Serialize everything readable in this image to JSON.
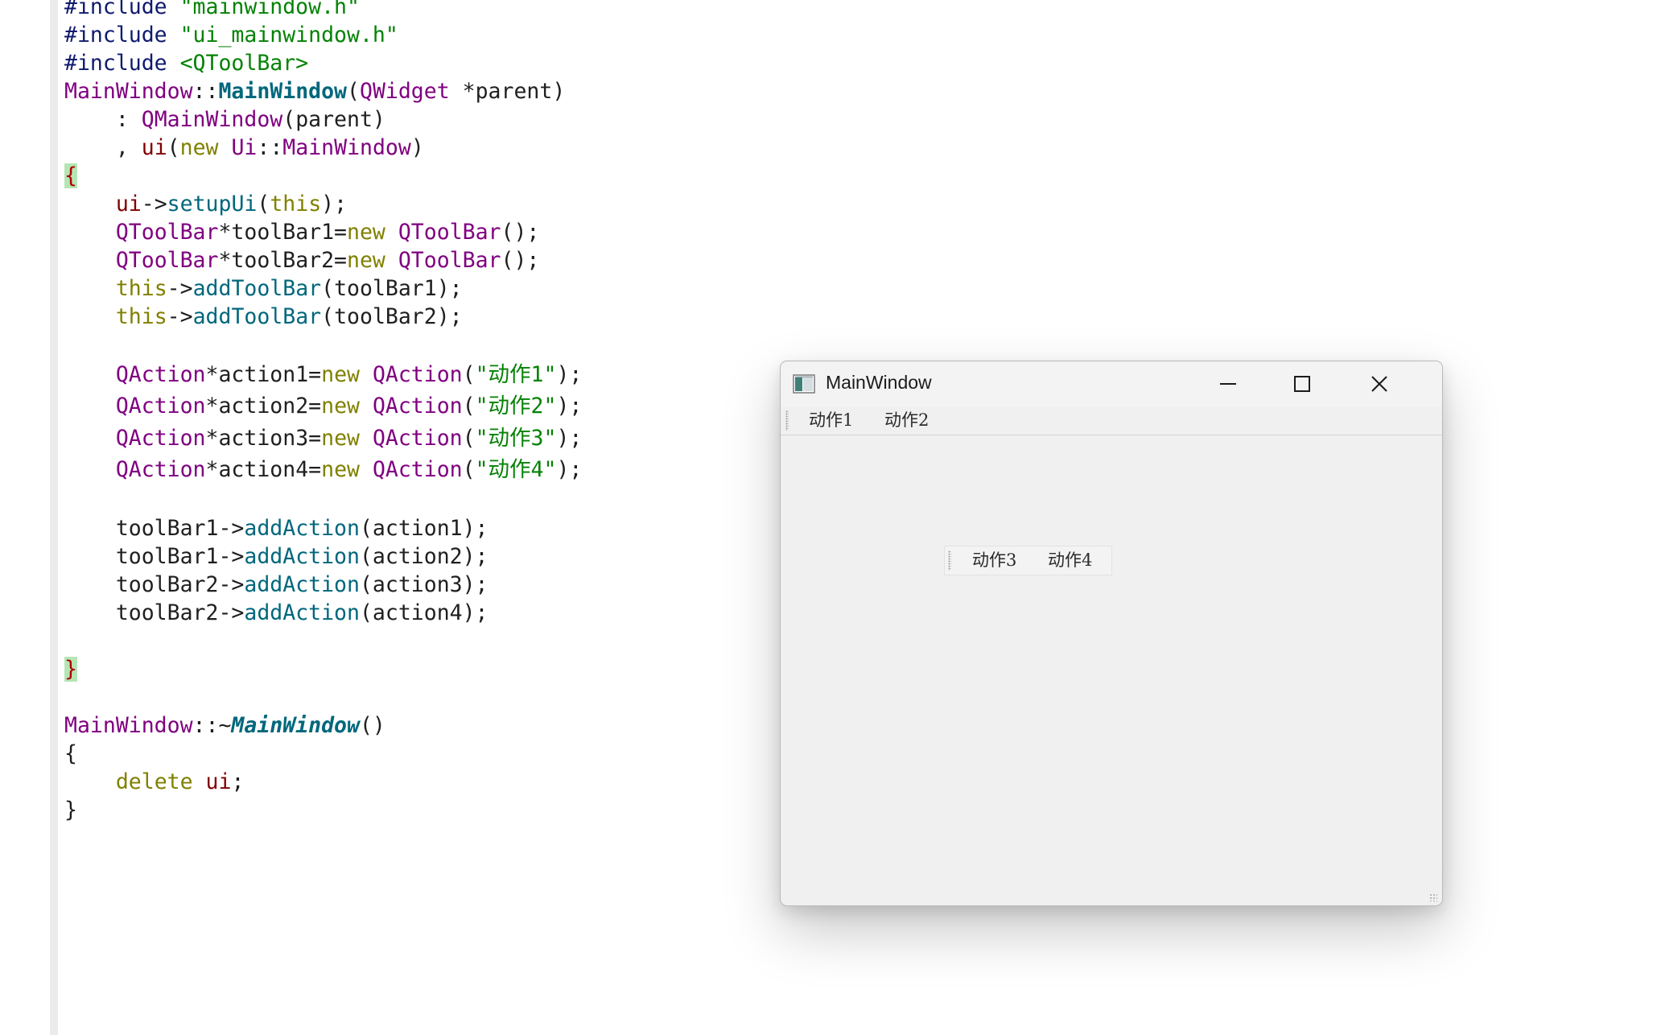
{
  "editor": {
    "lines": [
      [
        {
          "t": "#include ",
          "c": "tok-kw-pp"
        },
        {
          "t": "\"mainwindow.h\"",
          "c": "tok-str"
        }
      ],
      [
        {
          "t": "#include ",
          "c": "tok-kw-pp"
        },
        {
          "t": "\"ui_mainwindow.h\"",
          "c": "tok-str"
        }
      ],
      [
        {
          "t": "#include ",
          "c": "tok-kw-pp"
        },
        {
          "t": "<QToolBar>",
          "c": "tok-hdr"
        }
      ],
      [
        {
          "t": "MainWindow",
          "c": "tok-type"
        },
        {
          "t": "::",
          "c": "tok-punct"
        },
        {
          "t": "MainWindow",
          "c": "tok-fn-decl"
        },
        {
          "t": "(",
          "c": "tok-punct"
        },
        {
          "t": "QWidget",
          "c": "tok-type"
        },
        {
          "t": " *",
          "c": "tok-punct"
        },
        {
          "t": "parent",
          "c": "tok-plain"
        },
        {
          "t": ")",
          "c": "tok-punct"
        }
      ],
      [
        {
          "t": "    : ",
          "c": "tok-punct"
        },
        {
          "t": "QMainWindow",
          "c": "tok-type"
        },
        {
          "t": "(parent)",
          "c": "tok-punct"
        }
      ],
      [
        {
          "t": "    , ",
          "c": "tok-punct"
        },
        {
          "t": "ui",
          "c": "tok-member"
        },
        {
          "t": "(",
          "c": "tok-punct"
        },
        {
          "t": "new ",
          "c": "tok-kw"
        },
        {
          "t": "Ui",
          "c": "tok-type"
        },
        {
          "t": "::",
          "c": "tok-punct"
        },
        {
          "t": "MainWindow",
          "c": "tok-type"
        },
        {
          "t": ")",
          "c": "tok-punct"
        }
      ],
      [
        {
          "t": "{",
          "c": "tok-brace-hl"
        }
      ],
      [
        {
          "t": "    ",
          "c": "tok-plain"
        },
        {
          "t": "ui",
          "c": "tok-member"
        },
        {
          "t": "->",
          "c": "tok-punct"
        },
        {
          "t": "setupUi",
          "c": "tok-fn"
        },
        {
          "t": "(",
          "c": "tok-punct"
        },
        {
          "t": "this",
          "c": "tok-kw"
        },
        {
          "t": ");",
          "c": "tok-punct"
        }
      ],
      [
        {
          "t": "    ",
          "c": "tok-plain"
        },
        {
          "t": "QToolBar",
          "c": "tok-type"
        },
        {
          "t": "*toolBar1=",
          "c": "tok-punct"
        },
        {
          "t": "new ",
          "c": "tok-kw"
        },
        {
          "t": "QToolBar",
          "c": "tok-type"
        },
        {
          "t": "();",
          "c": "tok-punct"
        }
      ],
      [
        {
          "t": "    ",
          "c": "tok-plain"
        },
        {
          "t": "QToolBar",
          "c": "tok-type"
        },
        {
          "t": "*toolBar2=",
          "c": "tok-punct"
        },
        {
          "t": "new ",
          "c": "tok-kw"
        },
        {
          "t": "QToolBar",
          "c": "tok-type"
        },
        {
          "t": "();",
          "c": "tok-punct"
        }
      ],
      [
        {
          "t": "    ",
          "c": "tok-plain"
        },
        {
          "t": "this",
          "c": "tok-kw"
        },
        {
          "t": "->",
          "c": "tok-punct"
        },
        {
          "t": "addToolBar",
          "c": "tok-fn"
        },
        {
          "t": "(toolBar1);",
          "c": "tok-punct"
        }
      ],
      [
        {
          "t": "    ",
          "c": "tok-plain"
        },
        {
          "t": "this",
          "c": "tok-kw"
        },
        {
          "t": "->",
          "c": "tok-punct"
        },
        {
          "t": "addToolBar",
          "c": "tok-fn"
        },
        {
          "t": "(toolBar2);",
          "c": "tok-punct"
        }
      ],
      [],
      [
        {
          "t": "    ",
          "c": "tok-plain"
        },
        {
          "t": "QAction",
          "c": "tok-type"
        },
        {
          "t": "*action1=",
          "c": "tok-punct"
        },
        {
          "t": "new ",
          "c": "tok-kw"
        },
        {
          "t": "QAction",
          "c": "tok-type"
        },
        {
          "t": "(",
          "c": "tok-punct"
        },
        {
          "t": "\"动作1\"",
          "c": "tok-str"
        },
        {
          "t": ");",
          "c": "tok-punct"
        }
      ],
      [
        {
          "t": "    ",
          "c": "tok-plain"
        },
        {
          "t": "QAction",
          "c": "tok-type"
        },
        {
          "t": "*action2=",
          "c": "tok-punct"
        },
        {
          "t": "new ",
          "c": "tok-kw"
        },
        {
          "t": "QAction",
          "c": "tok-type"
        },
        {
          "t": "(",
          "c": "tok-punct"
        },
        {
          "t": "\"动作2\"",
          "c": "tok-str"
        },
        {
          "t": ");",
          "c": "tok-punct"
        }
      ],
      [
        {
          "t": "    ",
          "c": "tok-plain"
        },
        {
          "t": "QAction",
          "c": "tok-type"
        },
        {
          "t": "*action3=",
          "c": "tok-punct"
        },
        {
          "t": "new ",
          "c": "tok-kw"
        },
        {
          "t": "QAction",
          "c": "tok-type"
        },
        {
          "t": "(",
          "c": "tok-punct"
        },
        {
          "t": "\"动作3\"",
          "c": "tok-str"
        },
        {
          "t": ");",
          "c": "tok-punct"
        }
      ],
      [
        {
          "t": "    ",
          "c": "tok-plain"
        },
        {
          "t": "QAction",
          "c": "tok-type"
        },
        {
          "t": "*action4=",
          "c": "tok-punct"
        },
        {
          "t": "new ",
          "c": "tok-kw"
        },
        {
          "t": "QAction",
          "c": "tok-type"
        },
        {
          "t": "(",
          "c": "tok-punct"
        },
        {
          "t": "\"动作4\"",
          "c": "tok-str"
        },
        {
          "t": ");",
          "c": "tok-punct"
        }
      ],
      [],
      [
        {
          "t": "    toolBar1->",
          "c": "tok-plain"
        },
        {
          "t": "addAction",
          "c": "tok-fn"
        },
        {
          "t": "(action1);",
          "c": "tok-punct"
        }
      ],
      [
        {
          "t": "    toolBar1->",
          "c": "tok-plain"
        },
        {
          "t": "addAction",
          "c": "tok-fn"
        },
        {
          "t": "(action2);",
          "c": "tok-punct"
        }
      ],
      [
        {
          "t": "    toolBar2->",
          "c": "tok-plain"
        },
        {
          "t": "addAction",
          "c": "tok-fn"
        },
        {
          "t": "(action3);",
          "c": "tok-punct"
        }
      ],
      [
        {
          "t": "    toolBar2->",
          "c": "tok-plain"
        },
        {
          "t": "addAction",
          "c": "tok-fn"
        },
        {
          "t": "(action4);",
          "c": "tok-punct"
        }
      ],
      [],
      [
        {
          "t": "}",
          "c": "tok-brace-hl"
        }
      ],
      [],
      [
        {
          "t": "MainWindow",
          "c": "tok-type"
        },
        {
          "t": "::~",
          "c": "tok-punct"
        },
        {
          "t": "MainWindow",
          "c": "tok-fn-decl-it"
        },
        {
          "t": "()",
          "c": "tok-punct"
        }
      ],
      [
        {
          "t": "{",
          "c": "tok-punct"
        }
      ],
      [
        {
          "t": "    ",
          "c": "tok-plain"
        },
        {
          "t": "delete ",
          "c": "tok-kw"
        },
        {
          "t": "ui",
          "c": "tok-member"
        },
        {
          "t": ";",
          "c": "tok-punct"
        }
      ],
      [
        {
          "t": "}",
          "c": "tok-punct"
        }
      ]
    ]
  },
  "window": {
    "title": "MainWindow",
    "toolbar1": {
      "actions": [
        "动作1",
        "动作2"
      ]
    },
    "toolbar2": {
      "actions": [
        "动作3",
        "动作4"
      ]
    }
  }
}
